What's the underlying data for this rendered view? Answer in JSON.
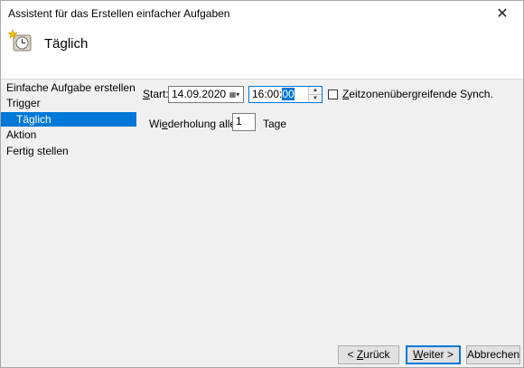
{
  "window": {
    "title": "Assistent für das Erstellen einfacher Aufgaben"
  },
  "header": {
    "title": "Täglich",
    "icon": "clock-task-icon"
  },
  "nav": {
    "items": [
      {
        "label": "Einfache Aufgabe erstellen"
      },
      {
        "label": "Trigger"
      },
      {
        "label": "Täglich",
        "selected": true
      },
      {
        "label": "Aktion"
      },
      {
        "label": "Fertig stellen"
      }
    ]
  },
  "form": {
    "start_label_u": "S",
    "start_label_rest": "tart:",
    "start_date": "14.09.2020",
    "start_time_prefix": "16:00:",
    "start_time_selected": "00",
    "sync_label_u": "Z",
    "sync_label_rest": "eitzonenübergreifende Synch.",
    "sync_checked": false,
    "repeat_label_pre": "Wi",
    "repeat_label_u": "e",
    "repeat_label_post": "derholung alle:",
    "repeat_value": "1",
    "repeat_unit": "Tage"
  },
  "buttons": {
    "back_pre": "< ",
    "back_u": "Z",
    "back_post": "urück",
    "next_u": "W",
    "next_post": "eiter >",
    "cancel": "Abbrechen"
  }
}
